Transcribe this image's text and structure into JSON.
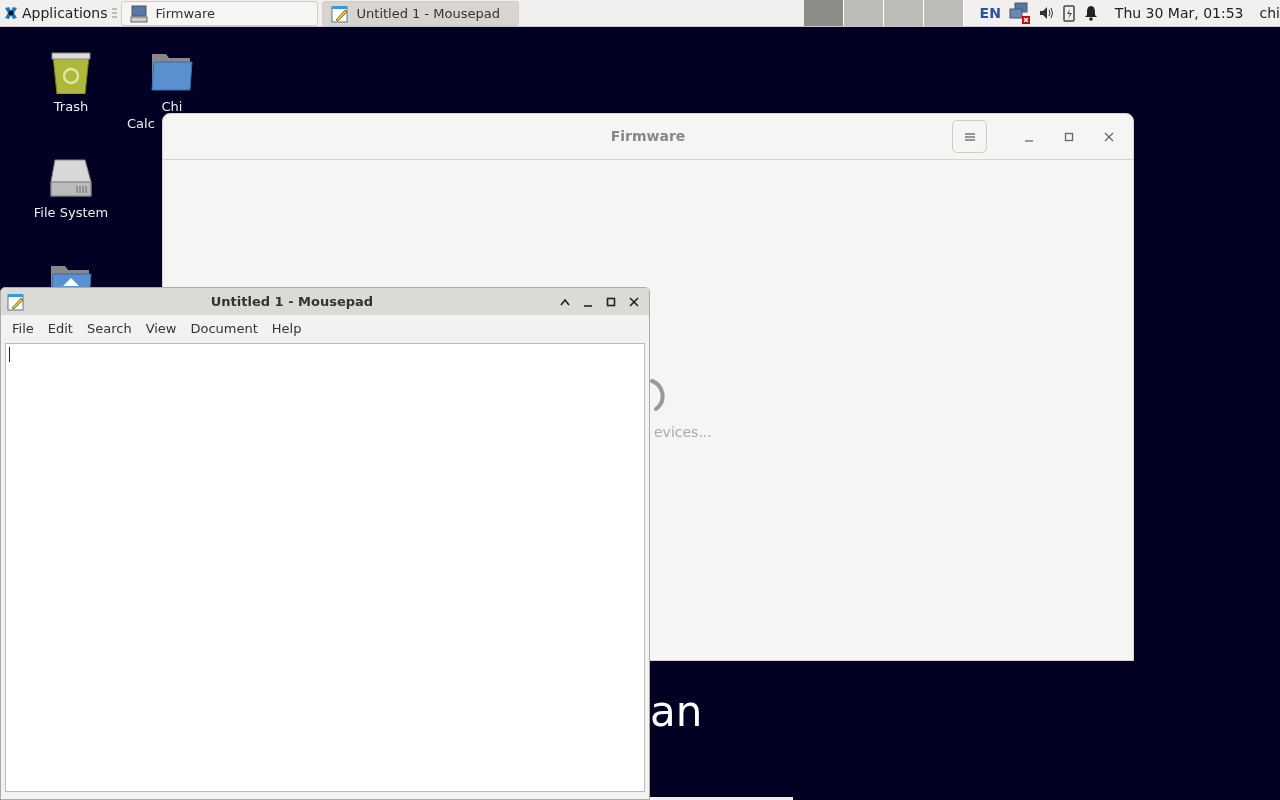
{
  "panel": {
    "apps_label": "Applications",
    "tasks": [
      {
        "title": "Firmware",
        "kind": "computer",
        "selected": false
      },
      {
        "title": "Untitled 1 - Mousepad",
        "kind": "notepad",
        "selected": true
      }
    ],
    "workspaces": [
      {
        "selected": true
      },
      {
        "selected": false
      },
      {
        "selected": false
      },
      {
        "selected": false
      }
    ],
    "keyboard": "EN",
    "clock": "Thu 30 Mar, 01:53",
    "user": "chi"
  },
  "desktop_icons": [
    {
      "kind": "trash",
      "lines": [
        "Trash"
      ]
    },
    {
      "kind": "folder",
      "lines": [
        "Chi",
        "Calc"
      ]
    },
    {
      "kind": "drive",
      "lines": [
        "File System"
      ]
    },
    {
      "kind": "home"
    }
  ],
  "wallpaper_text": "an",
  "firmware_window": {
    "title": "Firmware",
    "status": "evices..."
  },
  "mousepad_window": {
    "title": "Untitled 1 - Mousepad",
    "menu": [
      "File",
      "Edit",
      "Search",
      "View",
      "Document",
      "Help"
    ]
  }
}
